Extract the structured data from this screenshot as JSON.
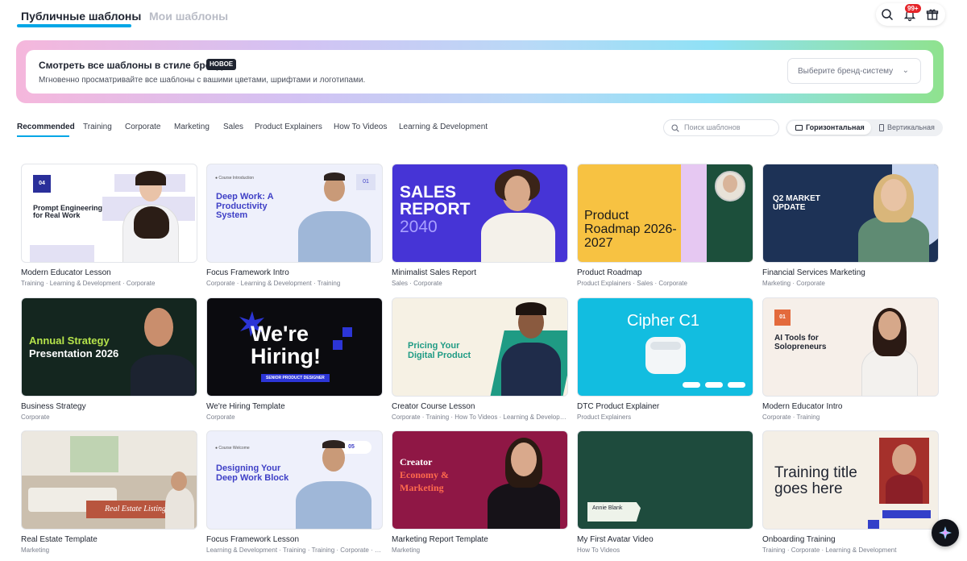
{
  "tabs": {
    "public": "Публичные шаблоны",
    "mine": "Мои шаблоны"
  },
  "toolbar": {
    "notifications_badge": "99+"
  },
  "brand_banner": {
    "title": "Смотреть все шаблоны в стиле бренда",
    "new_label": "НОВОЕ",
    "subtitle": "Мгновенно просматривайте все шаблоны с вашими цветами, шрифтами и логотипами.",
    "select_placeholder": "Выберите бренд-систему"
  },
  "categories": [
    "Recommended",
    "Training",
    "Corporate",
    "Marketing",
    "Sales",
    "Product Explainers",
    "How To Videos",
    "Learning & Development"
  ],
  "search": {
    "placeholder": "Поиск шаблонов"
  },
  "orientation": {
    "horizontal": "Горизонтальная",
    "vertical": "Вертикальная"
  },
  "colors": {
    "accent": "#00a6e6",
    "badge": "#e5252a"
  },
  "cards": [
    {
      "title": "Modern Educator Lesson",
      "tags": "Training · Learning & Development · Corporate",
      "thumb": {
        "heading": "Prompt Engineering for Real Work",
        "badge": "04"
      }
    },
    {
      "title": "Focus Framework Intro",
      "tags": "Corporate · Learning & Development · Training",
      "thumb": {
        "heading": "Deep Work: A Productivity System",
        "badge": "01"
      }
    },
    {
      "title": "Minimalist Sales Report",
      "tags": "Sales · Corporate",
      "thumb": {
        "heading": "SALES REPORT",
        "year": "2040"
      }
    },
    {
      "title": "Product Roadmap",
      "tags": "Product Explainers · Sales · Corporate",
      "thumb": {
        "heading": "Product Roadmap 2026-2027"
      }
    },
    {
      "title": "Financial Services Marketing",
      "tags": "Marketing · Corporate",
      "thumb": {
        "heading": "Q2 MARKET UPDATE"
      }
    },
    {
      "title": "Business Strategy",
      "tags": "Corporate",
      "thumb": {
        "heading1": "Annual Strategy",
        "heading2": "Presentation 2026"
      }
    },
    {
      "title": "We're Hiring Template",
      "tags": "Corporate",
      "thumb": {
        "heading": "We're Hiring!",
        "pill": "SENIOR PRODUCT DESIGNER"
      }
    },
    {
      "title": "Creator Course Lesson",
      "tags": "Corporate · Training · How To Videos · Learning & Development",
      "thumb": {
        "heading": "Pricing Your Digital Product"
      }
    },
    {
      "title": "DTC Product Explainer",
      "tags": "Product Explainers",
      "thumb": {
        "heading": "Cipher C1"
      }
    },
    {
      "title": "Modern Educator Intro",
      "tags": "Corporate · Training",
      "thumb": {
        "heading": "AI Tools for Solopreneurs",
        "badge": "01"
      }
    },
    {
      "title": "Real Estate Template",
      "tags": "Marketing",
      "thumb": {
        "heading": "Real Estate Listing"
      }
    },
    {
      "title": "Focus Framework Lesson",
      "tags": "Learning & Development · Training · Training · Corporate · Marketing",
      "thumb": {
        "heading": "Designing Your Deep Work Block",
        "badge": "05"
      }
    },
    {
      "title": "Marketing Report Template",
      "tags": "Marketing",
      "thumb": {
        "heading1": "Creator",
        "heading2": "Economy &",
        "heading3": "Marketing"
      }
    },
    {
      "title": "My First Avatar Video",
      "tags": "How To Videos",
      "thumb": {
        "label": "Annie Blank"
      }
    },
    {
      "title": "Onboarding Training",
      "tags": "Training · Corporate · Learning & Development",
      "thumb": {
        "heading": "Training title goes here"
      }
    }
  ]
}
